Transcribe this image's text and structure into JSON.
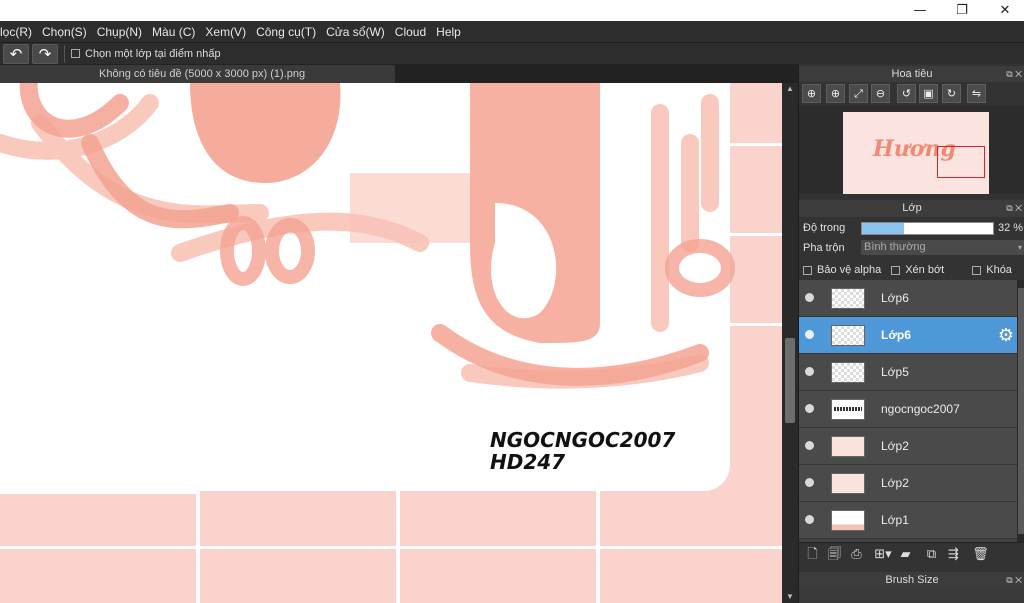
{
  "window": {
    "minimize_glyph": "—",
    "restore_glyph": "❐",
    "close_glyph": "✕"
  },
  "menu": [
    "lọc(R)",
    "Chọn(S)",
    "Chụp(N)",
    "Màu (C)",
    "Xem(V)",
    "Công cụ(T)",
    "Cửa sổ(W)",
    "Cloud",
    "Help"
  ],
  "toolbar": {
    "undo_icon": "undo-icon",
    "redo_icon": "redo-icon",
    "pick_layer_label": "Chọn một lớp tại điểm nhấp"
  },
  "document": {
    "tab_title": "Không có tiêu đề (5000 x 3000 px) (1).png"
  },
  "canvas": {
    "watermark_line1": "NGOCNGOC2007",
    "watermark_line2": "HD247",
    "stroke_color": "#f4a392",
    "bg_color": "#fad4cc"
  },
  "navigator": {
    "title": "Hoa tiêu",
    "thumb_text": "Hương"
  },
  "layers_panel": {
    "title": "Lớp",
    "opacity_label": "Độ trong",
    "opacity_value": "32 %",
    "opacity_fraction": 0.32,
    "blend_label": "Pha trộn",
    "blend_value": "Bình thường",
    "protect_alpha": "Bảo vệ alpha",
    "clipping": "Xén bớt",
    "lock": "Khóa",
    "layers": [
      {
        "name": "Lớp6",
        "active": false
      },
      {
        "name": "Lớp6",
        "active": true
      },
      {
        "name": "Lớp5",
        "active": false
      },
      {
        "name": "ngocngoc2007",
        "active": false
      },
      {
        "name": "Lớp2",
        "active": false
      },
      {
        "name": "Lớp2",
        "active": false
      },
      {
        "name": "Lớp1",
        "active": false
      }
    ]
  },
  "brush_size": {
    "title": "Brush Size"
  },
  "colors": {
    "accent": "#4f98d8",
    "panel": "#333333",
    "selection_rect": "#e0222b"
  }
}
